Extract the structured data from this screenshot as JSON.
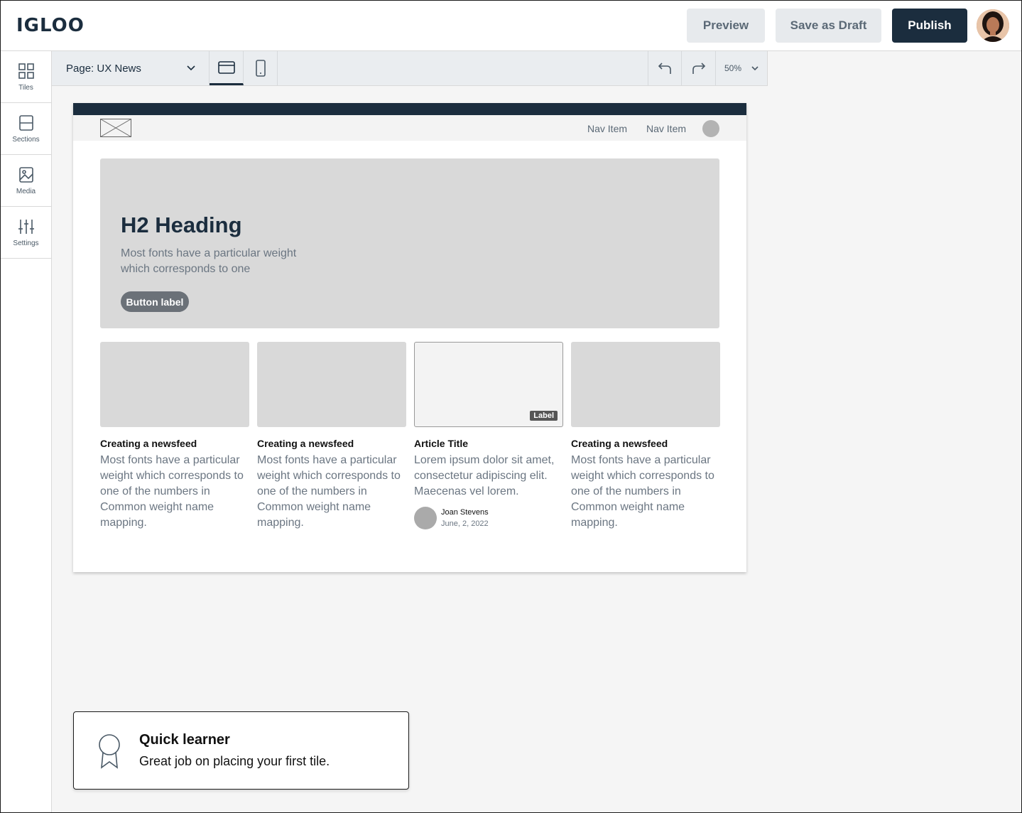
{
  "header": {
    "logo": "IGLOO",
    "preview_label": "Preview",
    "save_draft_label": "Save as Draft",
    "publish_label": "Publish"
  },
  "sidebar": {
    "items": [
      {
        "label": "Tiles",
        "icon": "tiles-icon"
      },
      {
        "label": "Sections",
        "icon": "sections-icon"
      },
      {
        "label": "Media",
        "icon": "media-icon"
      },
      {
        "label": "Settings",
        "icon": "sliders-icon"
      }
    ]
  },
  "toolbar": {
    "page_select": "Page: UX News",
    "zoom": "50%",
    "active_view": "desktop"
  },
  "canvas": {
    "nav_items": [
      "Nav Item",
      "Nav Item"
    ],
    "hero": {
      "title": "H2 Heading",
      "body": "Most fonts have a particular weight which corresponds to one",
      "button_label": "Button label"
    },
    "cards": [
      {
        "title": "Creating a newsfeed",
        "body": "Most fonts have a particular weight which corresponds to one of the numbers in Common weight name mapping."
      },
      {
        "title": "Creating a newsfeed",
        "body": "Most fonts have a particular weight which corresponds to one of the numbers in Common weight name mapping."
      },
      {
        "title": "Article Title",
        "body": "Lorem ipsum dolor sit amet, consectetur adipiscing elit. Maecenas vel lorem.",
        "badge": "Label",
        "author": "Joan Stevens",
        "date": "June, 2, 2022"
      },
      {
        "title": "Creating a newsfeed",
        "body": "Most fonts have a particular weight which corresponds to one of the numbers in Common weight name mapping."
      }
    ]
  },
  "toast": {
    "title": "Quick learner",
    "body": "Great job on placing your first tile.",
    "icon": "award-ribbon-icon"
  },
  "colors": {
    "primary": "#1b2d3e",
    "secondary_button_bg": "#e7eaed",
    "placeholder": "#d9d9d9"
  }
}
